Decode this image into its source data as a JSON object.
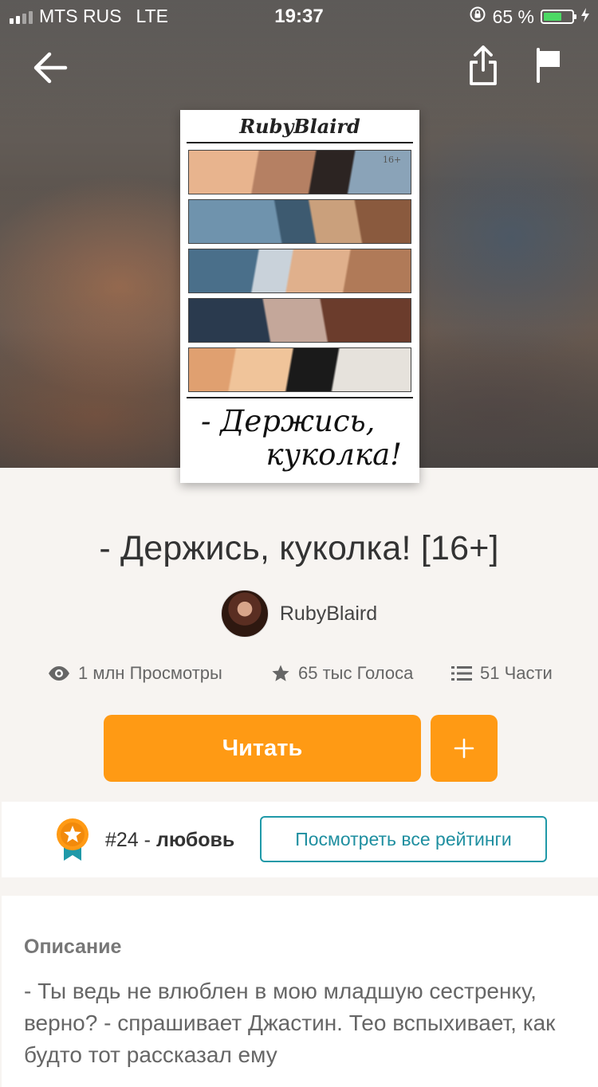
{
  "status_bar": {
    "carrier": "MTS RUS",
    "network": "LTE",
    "time": "19:37",
    "battery_percent": "65 %",
    "battery_level": 0.65
  },
  "icons": {
    "back": "arrow-left-icon",
    "share": "share-icon",
    "report": "flag-icon",
    "views": "eye-icon",
    "votes": "star-icon",
    "parts": "list-icon",
    "rank": "ribbon-badge-icon"
  },
  "cover": {
    "author_text": "RubyBlaird",
    "age_tag": "16+",
    "title_line1": "- Держись,",
    "title_line2": "куколка!"
  },
  "story": {
    "title": "- Держись, куколка! [16+]",
    "author": "RubyBlaird"
  },
  "stats": {
    "views": "1 млн Просмотры",
    "votes": "65 тыс Голоса",
    "parts": "51 Части"
  },
  "actions": {
    "read_label": "Читать",
    "add_label": "+"
  },
  "ranking": {
    "rank": "#24",
    "separator": " - ",
    "category": "любовь",
    "button_label": "Посмотреть все рейтинги"
  },
  "description": {
    "heading": "Описание",
    "text": "- Ты ведь не влюблен в мою младшую сестренку, верно? - спрашивает Джастин. Тео вспыхивает, как будто тот рассказал ему"
  },
  "colors": {
    "accent": "#ff9a14",
    "teal": "#1f99a8",
    "page_bg": "#f7f4f1"
  }
}
